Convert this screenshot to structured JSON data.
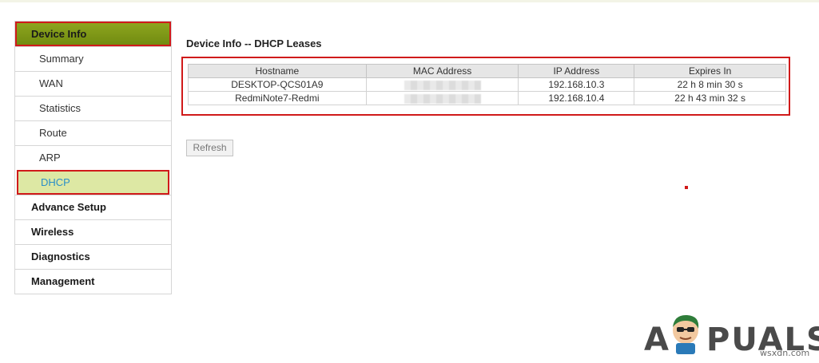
{
  "sidebar": {
    "head": "Device Info",
    "items": [
      "Summary",
      "WAN",
      "Statistics",
      "Route",
      "ARP",
      "DHCP"
    ],
    "active_item": "DHCP",
    "sections": [
      "Advance Setup",
      "Wireless",
      "Diagnostics",
      "Management"
    ]
  },
  "main": {
    "title": "Device Info -- DHCP Leases",
    "table": {
      "headers": [
        "Hostname",
        "MAC Address",
        "IP Address",
        "Expires In"
      ],
      "rows": [
        {
          "hostname": "DESKTOP-QCS01A9",
          "ip": "192.168.10.3",
          "expires": "22 h 8 min 30 s"
        },
        {
          "hostname": "RedmiNote7-Redmi",
          "ip": "192.168.10.4",
          "expires": "22 h 43 min 32 s"
        }
      ]
    },
    "refresh_label": "Refresh"
  },
  "watermark": {
    "logo_text": "APPUALS",
    "site": "wsxdn.com"
  },
  "colors": {
    "sidebar_head": "#7f9a17",
    "active_item_bg": "#dde8a4",
    "active_item_text": "#2a8fc8",
    "highlight_border": "#d01a1a"
  }
}
